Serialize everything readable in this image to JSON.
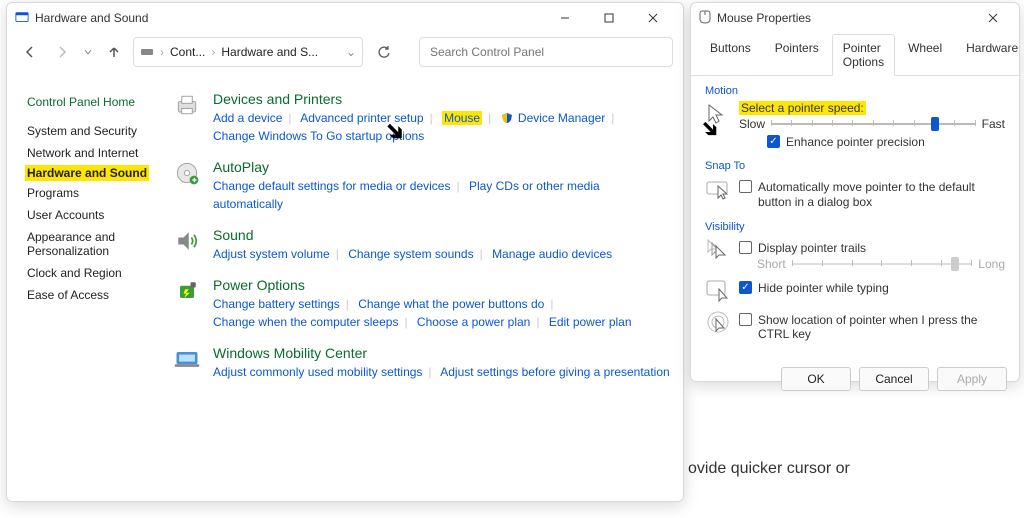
{
  "cp": {
    "title": "Hardware and Sound",
    "breadcrumb1": "Cont...",
    "breadcrumb2": "Hardware and S...",
    "search_placeholder": "Search Control Panel",
    "home": "Control Panel Home",
    "side": {
      "s0": "System and Security",
      "s1": "Network and Internet",
      "s2": "Hardware and Sound",
      "s3": "Programs",
      "s4": "User Accounts",
      "s5": "Appearance and Personalization",
      "s6": "Clock and Region",
      "s7": "Ease of Access"
    },
    "cats": {
      "devices": {
        "h": "Devices and Printers",
        "l0": "Add a device",
        "l1": "Advanced printer setup",
        "l2": "Mouse",
        "l3": "Device Manager",
        "l4": "Change Windows To Go startup options"
      },
      "autoplay": {
        "h": "AutoPlay",
        "l0": "Change default settings for media or devices",
        "l1": "Play CDs or other media automatically"
      },
      "sound": {
        "h": "Sound",
        "l0": "Adjust system volume",
        "l1": "Change system sounds",
        "l2": "Manage audio devices"
      },
      "power": {
        "h": "Power Options",
        "l0": "Change battery settings",
        "l1": "Change what the power buttons do",
        "l2": "Change when the computer sleeps",
        "l3": "Choose a power plan",
        "l4": "Edit power plan"
      },
      "mobility": {
        "h": "Windows Mobility Center",
        "l0": "Adjust commonly used mobility settings",
        "l1": "Adjust settings before giving a presentation"
      }
    }
  },
  "mp": {
    "title": "Mouse Properties",
    "tabs": {
      "t0": "Buttons",
      "t1": "Pointers",
      "t2": "Pointer Options",
      "t3": "Wheel",
      "t4": "Hardware"
    },
    "motion": {
      "legend": "Motion",
      "label": "Select a pointer speed:",
      "slow": "Slow",
      "fast": "Fast",
      "enhance": "Enhance pointer precision"
    },
    "snap": {
      "legend": "Snap To",
      "label": "Automatically move pointer to the default button in a dialog box"
    },
    "vis": {
      "legend": "Visibility",
      "trails": "Display pointer trails",
      "short": "Short",
      "long": "Long",
      "hide": "Hide pointer while typing",
      "ctrl": "Show location of pointer when I press the CTRL key"
    },
    "btn_ok": "OK",
    "btn_cancel": "Cancel",
    "btn_apply": "Apply"
  },
  "bg_text": "ovide quicker cursor or"
}
